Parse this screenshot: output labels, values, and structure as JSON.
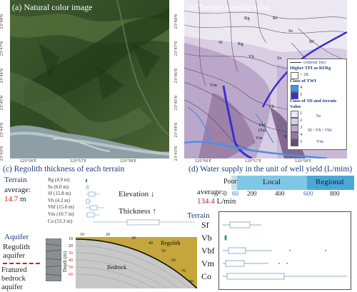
{
  "panel_a": {
    "title": "(a) Natural color image",
    "lon_ticks": [
      "120°56'E",
      "120°57'E",
      "120°58'E"
    ],
    "lat_ticks": [
      "23°48'N",
      "23°47'N",
      "23°46'N",
      "23°45'N",
      "23°44'N",
      "23°43'N"
    ]
  },
  "panel_b": {
    "title": "(b) Terrain classification",
    "lon_ticks": [
      "120°56'E",
      "120°57'E",
      "120°58'E"
    ],
    "lat_ticks": [
      "23°48'N",
      "23°47'N",
      "23°46'N",
      "23°45'N",
      "23°44'N",
      "23°43'N"
    ],
    "map_labels": [
      "Rg",
      "Rf",
      "Ss",
      "Sf",
      "Rg",
      "Vb",
      "Ss",
      "Rf",
      "Vm",
      "Vb",
      "Vbf (Ss)",
      "Vm",
      "Ss"
    ],
    "legend": {
      "contour": "contour (m)",
      "tpi_head": "Higher TPI as Rf/Rg",
      "tpi_value": "> 28",
      "twi_head": "Class of TWI",
      "twi_values": [
        "4",
        "5"
      ],
      "sd_head": "Class of SD and terrain",
      "sd_value_head": "Value",
      "sd_values": [
        "1",
        "2",
        "3",
        "4",
        "5"
      ],
      "sd_terrain": [
        "Ss",
        "Sf / Vb / Vbf",
        "Vm"
      ]
    },
    "colors": {
      "twi4": "#4a90e8",
      "twi5": "#3a2fd0",
      "sd1": "#ece8f2",
      "sd2": "#d8cde2",
      "sd3": "#bba7c9",
      "sd4": "#96789f",
      "sd5": "#6b4d77"
    }
  },
  "panel_c": {
    "title": "(c) Regolith thickness of each terrain",
    "terrain_label": "Terrain",
    "average_label": "average:",
    "average_value": "14.7",
    "average_unit": "m",
    "rows": [
      {
        "name": "Rg",
        "value": "(4.9 m)"
      },
      {
        "name": "Ss",
        "value": "(6.0 m)"
      },
      {
        "name": "Sf",
        "value": "(15.8 m)"
      },
      {
        "name": "Vb",
        "value": "(4.2 m)"
      },
      {
        "name": "Vbf",
        "value": "(15.0 m)"
      },
      {
        "name": "Vm",
        "value": "(10.7 m)"
      },
      {
        "name": "Co",
        "value": "(53.3 m)"
      }
    ],
    "elevation_label": "Elevation",
    "elevation_arrow": "↓",
    "thickness_label": "Thickness",
    "thickness_arrow": "↑",
    "aquifer_head": "Aquifer",
    "regolith_aquifer": "Regolith aquifer",
    "bedrock_aquifer": "Fratured bedrock aquifer",
    "depth_label": "Depth (m)",
    "depth_ticks": [
      "10",
      "20",
      "30",
      "40",
      "50",
      "60"
    ],
    "diagram_ticks": [
      "10",
      "20",
      "30",
      "40",
      "50",
      "60",
      "70",
      "80"
    ],
    "regolith_label": "Regolith",
    "bedrock_label": "Bedrock"
  },
  "panel_d": {
    "title": "(d) Water supply in the unit of well yield (L/mim)",
    "average_label": "average:",
    "average_value": "134.4",
    "average_unit": "L/min",
    "scale": {
      "poor": "Poor",
      "local": "Local",
      "regional": "Regional",
      "ticks": [
        "0",
        "60",
        "200",
        "400",
        "600",
        "800"
      ]
    },
    "terrain_label": "Terrain",
    "rows": [
      "Sf",
      "Vb",
      "Vbf",
      "Vm",
      "Co"
    ]
  }
}
